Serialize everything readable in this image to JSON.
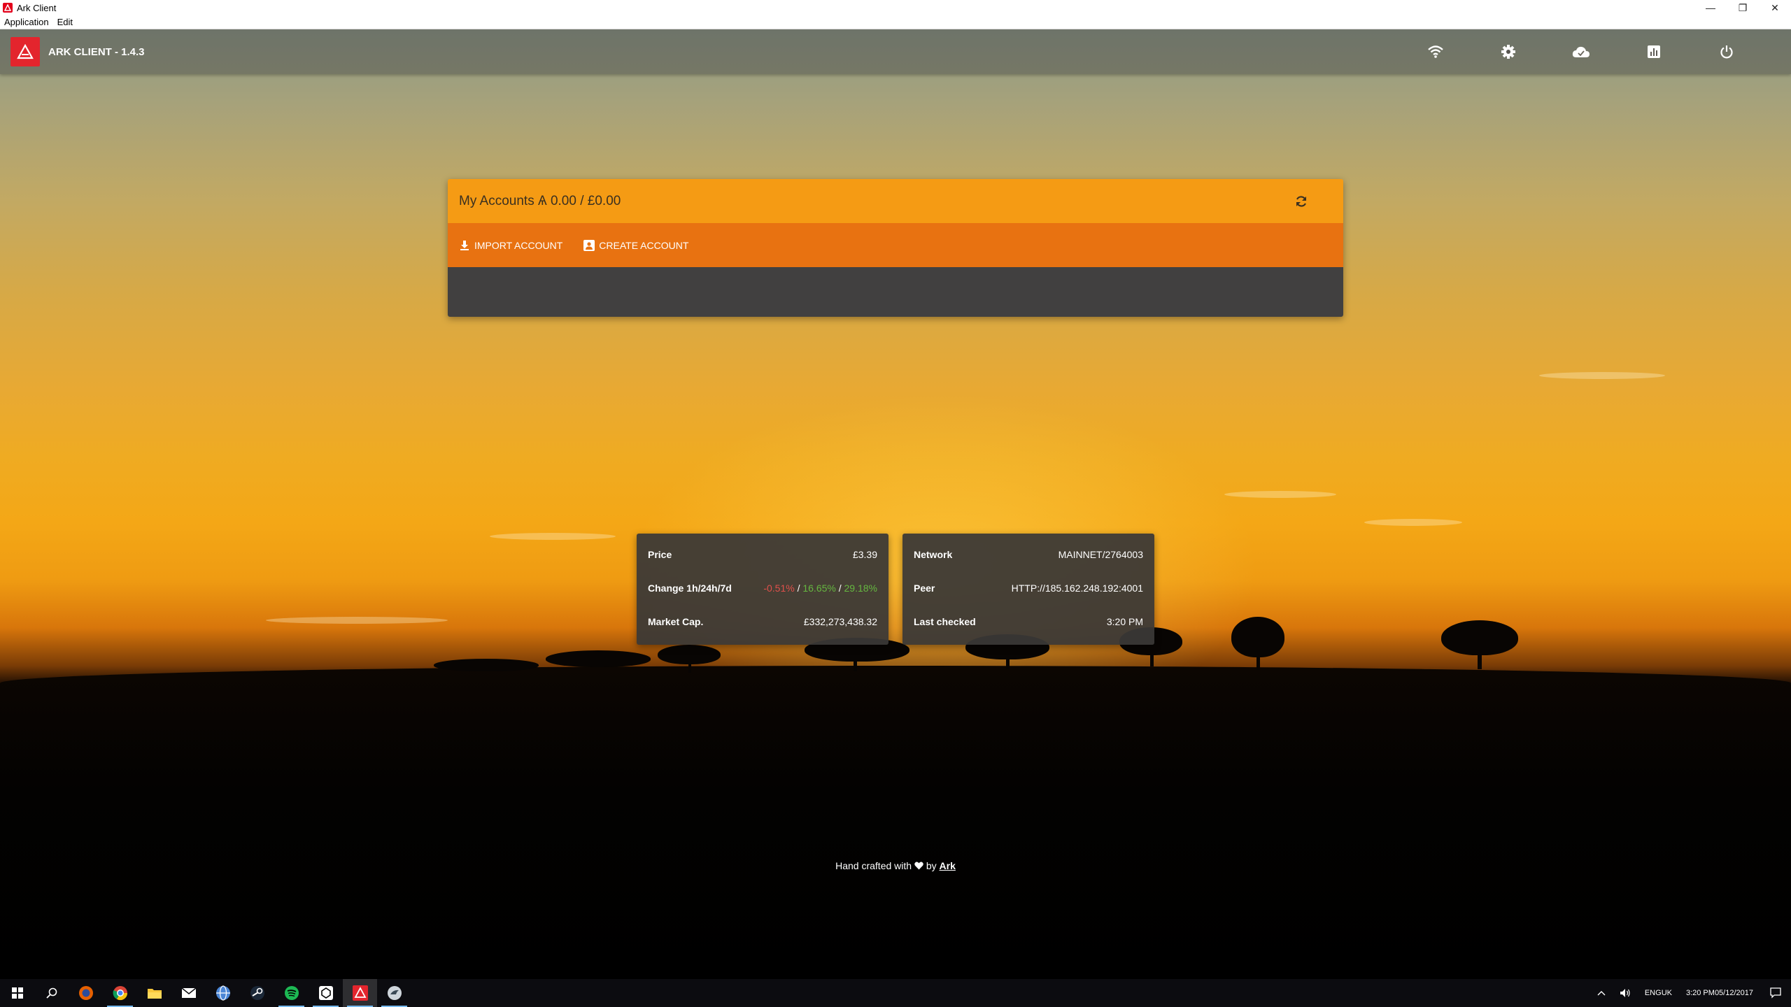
{
  "window": {
    "title": "Ark Client",
    "minimize": "—",
    "restore": "❐",
    "close": "✕"
  },
  "menu": [
    "Application",
    "Edit"
  ],
  "header": {
    "title": "ARK CLIENT - 1.4.3",
    "icons": [
      "wifi-icon",
      "settings-icon",
      "cloud-icon",
      "chart-icon",
      "power-icon"
    ]
  },
  "accounts": {
    "title": "My Accounts Ѧ 0.00 / £0.00",
    "import_label": "IMPORT ACCOUNT",
    "create_label": "CREATE ACCOUNT"
  },
  "price_card": {
    "price_label": "Price",
    "price_value": "£3.39",
    "change_label": "Change 1h/24h/7d",
    "change_1h": "-0.51%",
    "change_24h": "16.65%",
    "change_7d": "29.18%",
    "sep": "/",
    "market_cap_label": "Market Cap.",
    "market_cap_value": "£332,273,438.32"
  },
  "network_card": {
    "network_label": "Network",
    "network_value": "MAINNET/2764003",
    "peer_label": "Peer",
    "peer_value": "HTTP://185.162.248.192:4001",
    "last_checked_label": "Last checked",
    "last_checked_value": "3:20 PM"
  },
  "footer": {
    "text": "Hand crafted with",
    "by": "by",
    "link": "Ark"
  },
  "taskbar": {
    "lang": "ENG",
    "region": "UK",
    "time": "3:20 PM",
    "date": "05/12/2017",
    "tray_up": "^"
  },
  "colors": {
    "accent": "#e3252d",
    "accounts_header": "#f59b14",
    "accounts_actions": "#e87211",
    "negative": "#e0504b",
    "positive": "#65b840"
  }
}
